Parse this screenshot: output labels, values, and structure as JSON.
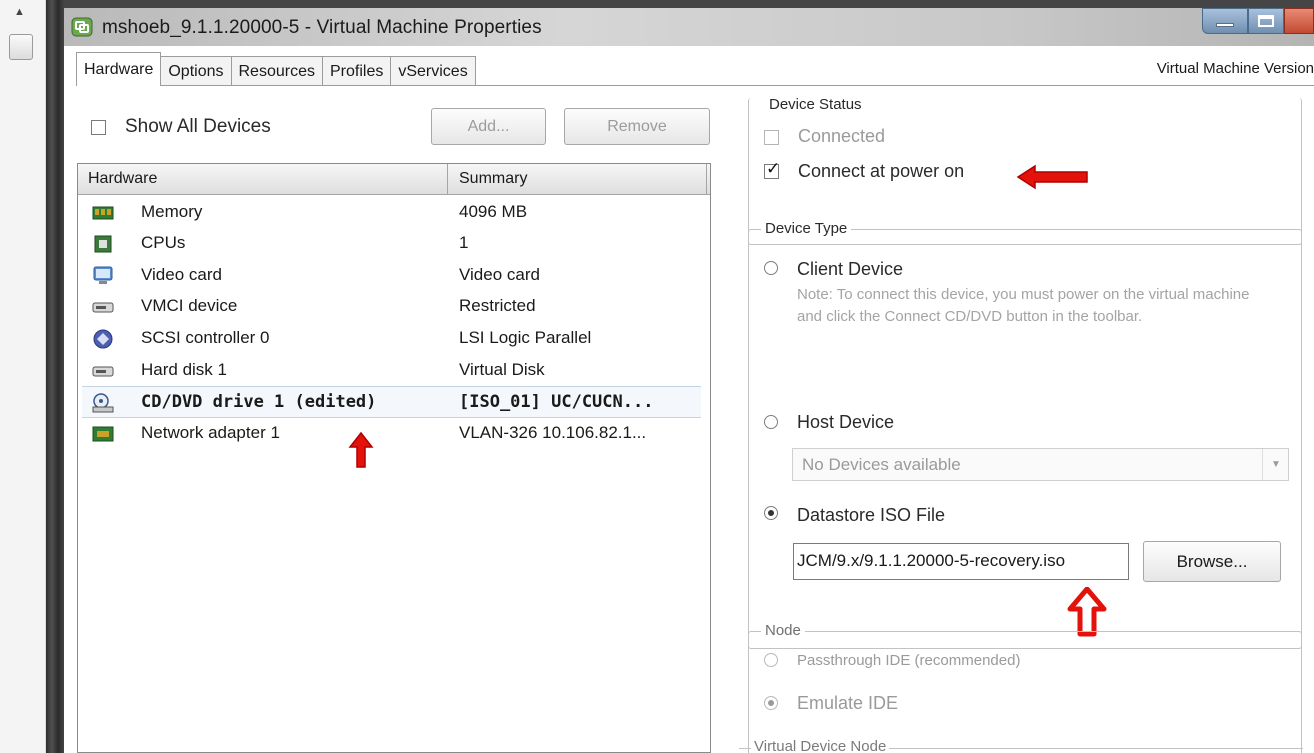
{
  "window": {
    "title": "mshoeb_9.1.1.20000-5 - Virtual Machine Properties",
    "version_label": "Virtual Machine Version"
  },
  "tabs": [
    {
      "label": "Hardware",
      "active": true
    },
    {
      "label": "Options"
    },
    {
      "label": "Resources"
    },
    {
      "label": "Profiles"
    },
    {
      "label": "vServices"
    }
  ],
  "toolbar": {
    "show_all_label": "Show All Devices",
    "show_all_checked": false,
    "add_label": "Add...",
    "remove_label": "Remove"
  },
  "hardware_table": {
    "columns": [
      "Hardware",
      "Summary"
    ],
    "rows": [
      {
        "name": "Memory",
        "summary": "4096 MB",
        "icon": "memory-icon"
      },
      {
        "name": "CPUs",
        "summary": "1",
        "icon": "cpu-icon"
      },
      {
        "name": "Video card",
        "summary": "Video card",
        "icon": "monitor-icon"
      },
      {
        "name": "VMCI device",
        "summary": "Restricted",
        "icon": "device-icon"
      },
      {
        "name": "SCSI controller 0",
        "summary": "LSI Logic Parallel",
        "icon": "scsi-icon"
      },
      {
        "name": "Hard disk 1",
        "summary": "Virtual Disk",
        "icon": "harddisk-icon"
      },
      {
        "name": "CD/DVD drive 1 (edited)",
        "summary": "[ISO_01] UC/CUCN...",
        "icon": "cd-dvd-icon",
        "selected": true
      },
      {
        "name": "Network adapter 1",
        "summary": "VLAN-326 10.106.82.1...",
        "icon": "network-icon"
      }
    ]
  },
  "device_status": {
    "legend": "Device Status",
    "connected_label": "Connected",
    "connected_checked": false,
    "connect_power_label": "Connect at power on",
    "connect_power_checked": true
  },
  "device_type": {
    "legend": "Device Type",
    "client_label": "Client Device",
    "client_note": "Note: To connect this device, you must power on the virtual machine and click the Connect CD/DVD button in the toolbar.",
    "host_label": "Host Device",
    "host_value": "No Devices available",
    "datastore_label": "Datastore ISO File",
    "datastore_selected": true,
    "iso_path": "JCM/9.x/9.1.1.20000-5-recovery.iso",
    "browse_label": "Browse..."
  },
  "node": {
    "legend": "Node",
    "passthrough_label": "Passthrough IDE (recommended)",
    "emulate_label": "Emulate IDE",
    "emulate_selected": true
  },
  "virtual_device_node": {
    "legend": "Virtual Device Node"
  },
  "colors": {
    "annotation_red": "#e3120b",
    "selection_bg": "#f4f7fb",
    "disabled_text": "#9a9a9a"
  }
}
